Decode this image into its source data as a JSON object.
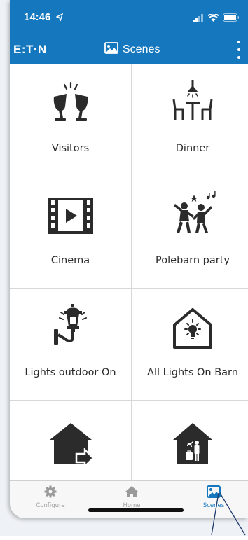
{
  "status_bar": {
    "time": "14:46"
  },
  "header": {
    "logo_text": "E:T·N",
    "title": "Scenes",
    "bg_color": "#1578bf"
  },
  "scenes": [
    {
      "label": "Visitors",
      "icon": "wine-glasses-cheers-icon"
    },
    {
      "label": "Dinner",
      "icon": "dining-table-lamp-icon"
    },
    {
      "label": "Cinema",
      "icon": "film-play-icon"
    },
    {
      "label": "Polebarn party",
      "icon": "dancing-people-icon"
    },
    {
      "label": "Lights outdoor On",
      "icon": "wall-lantern-icon"
    },
    {
      "label": "All Lights On Barn",
      "icon": "house-lightbulb-icon"
    },
    {
      "label": "",
      "icon": "house-leave-icon"
    },
    {
      "label": "",
      "icon": "house-person-travel-icon"
    }
  ],
  "tabbar": {
    "tabs": [
      {
        "label": "Configure",
        "icon": "gear-icon",
        "active": false
      },
      {
        "label": "Home",
        "icon": "home-icon",
        "active": false
      },
      {
        "label": "Scenes",
        "icon": "scenes-image-icon",
        "active": true
      }
    ]
  }
}
